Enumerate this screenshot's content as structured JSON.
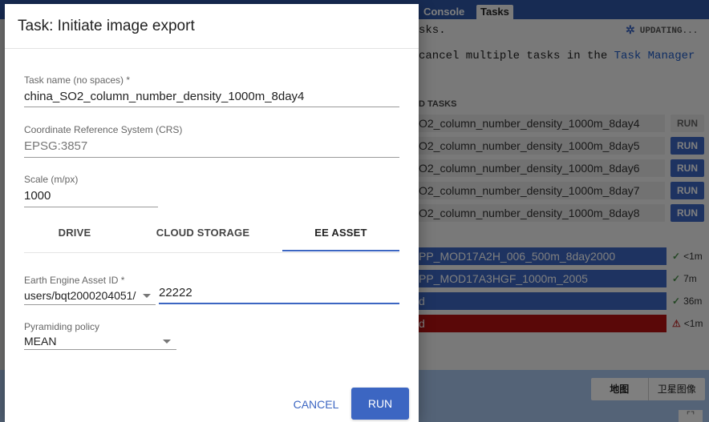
{
  "background": {
    "tabs": [
      "Console",
      "Tasks"
    ],
    "updating_label": "UPDATING...",
    "text_line1": "sks.",
    "text_line2_prefix": "cancel multiple tasks in the ",
    "text_line2_link": "Task Manager",
    "unsubmitted_header": "D TASKS",
    "unsubmitted_tasks": [
      {
        "name": "O2_column_number_density_1000m_8day4",
        "run": "RUN",
        "enabled": false
      },
      {
        "name": "O2_column_number_density_1000m_8day5",
        "run": "RUN",
        "enabled": true
      },
      {
        "name": "O2_column_number_density_1000m_8day6",
        "run": "RUN",
        "enabled": true
      },
      {
        "name": "O2_column_number_density_1000m_8day7",
        "run": "RUN",
        "enabled": true
      },
      {
        "name": "O2_column_number_density_1000m_8day8",
        "run": "RUN",
        "enabled": true
      }
    ],
    "completed_tasks": [
      {
        "name": "PP_MOD17A2H_006_500m_8day2000",
        "status": "<1m",
        "error": false
      },
      {
        "name": "PP_MOD17A3HGF_1000m_2005",
        "status": "7m",
        "error": false
      },
      {
        "name": "d",
        "status": "36m",
        "error": false
      },
      {
        "name": "d",
        "status": "<1m",
        "error": true
      }
    ],
    "map_toggle": [
      "地图",
      "卫星图像"
    ]
  },
  "dialog": {
    "title": "Task: Initiate image export",
    "task_name_label": "Task name (no spaces) *",
    "task_name_value": "china_SO2_column_number_density_1000m_8day4",
    "crs_label": "Coordinate Reference System (CRS)",
    "crs_value": "EPSG:3857",
    "scale_label": "Scale (m/px)",
    "scale_value": "1000",
    "tabs": [
      "DRIVE",
      "CLOUD STORAGE",
      "EE ASSET"
    ],
    "active_tab": "EE ASSET",
    "asset_id_label": "Earth Engine Asset ID *",
    "asset_prefix": "users/bqt2000204051/",
    "asset_id_value": "22222",
    "pyramiding_label": "Pyramiding policy",
    "pyramiding_value": "MEAN",
    "cancel_label": "CANCEL",
    "run_label": "RUN"
  },
  "colors": {
    "accent": "#3c66c2",
    "error": "#b51111"
  }
}
